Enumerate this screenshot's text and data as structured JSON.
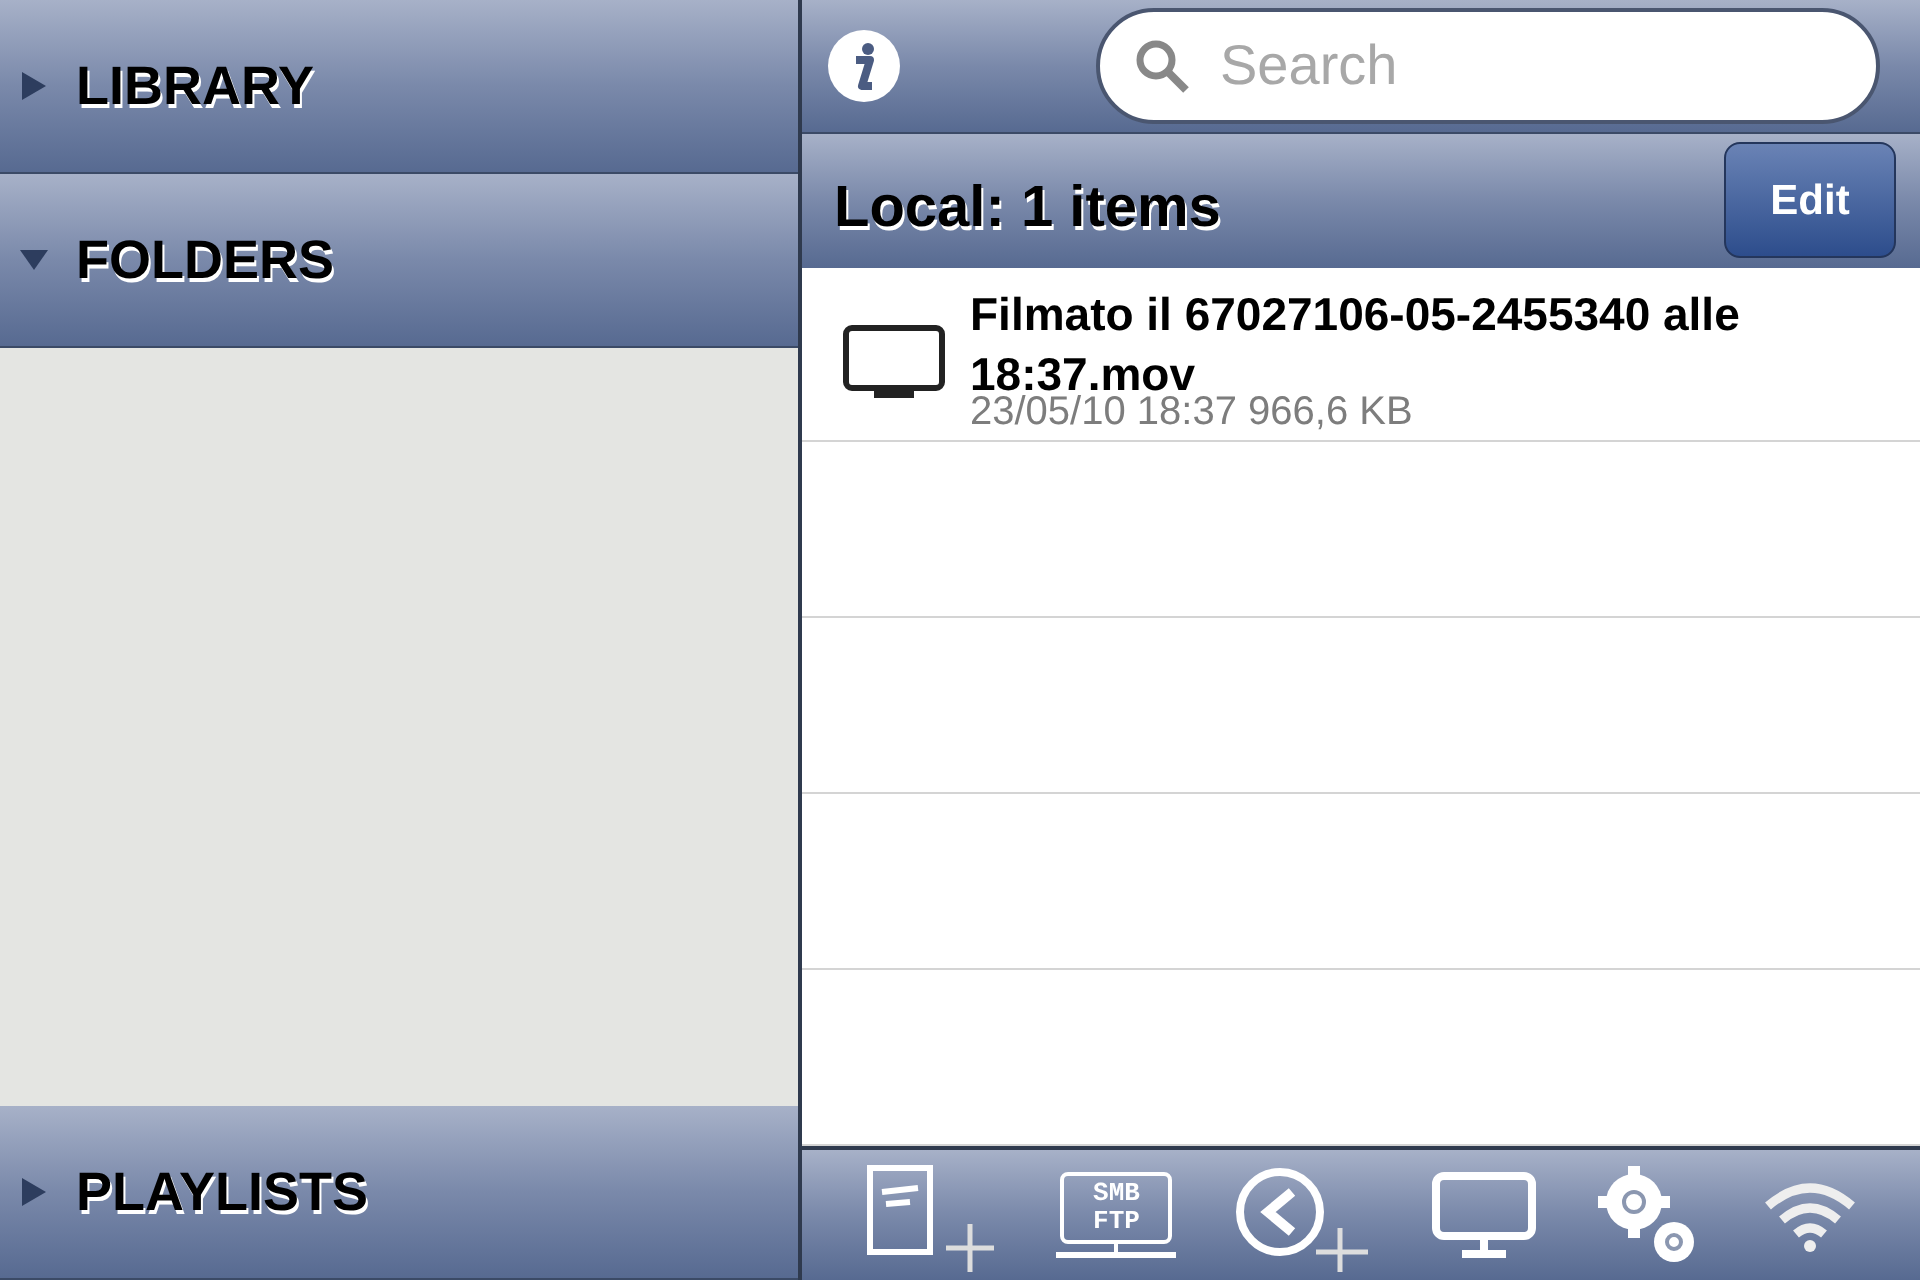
{
  "sidebar": {
    "sections": [
      {
        "label": "LIBRARY",
        "expanded": false
      },
      {
        "label": "FOLDERS",
        "expanded": true
      },
      {
        "label": "PLAYLISTS",
        "expanded": false
      }
    ]
  },
  "search": {
    "placeholder": "Search"
  },
  "list_header": {
    "title": "Local: 1 items",
    "edit_button": "Edit"
  },
  "files": [
    {
      "name": "Filmato il 67027106-05-2455340 alle 18:37.mov",
      "details": "23/05/10 18:37 966,6 KB"
    }
  ],
  "toolbar": {
    "smb_ftp_icon_lines": [
      "SMB",
      "FTP"
    ]
  }
}
